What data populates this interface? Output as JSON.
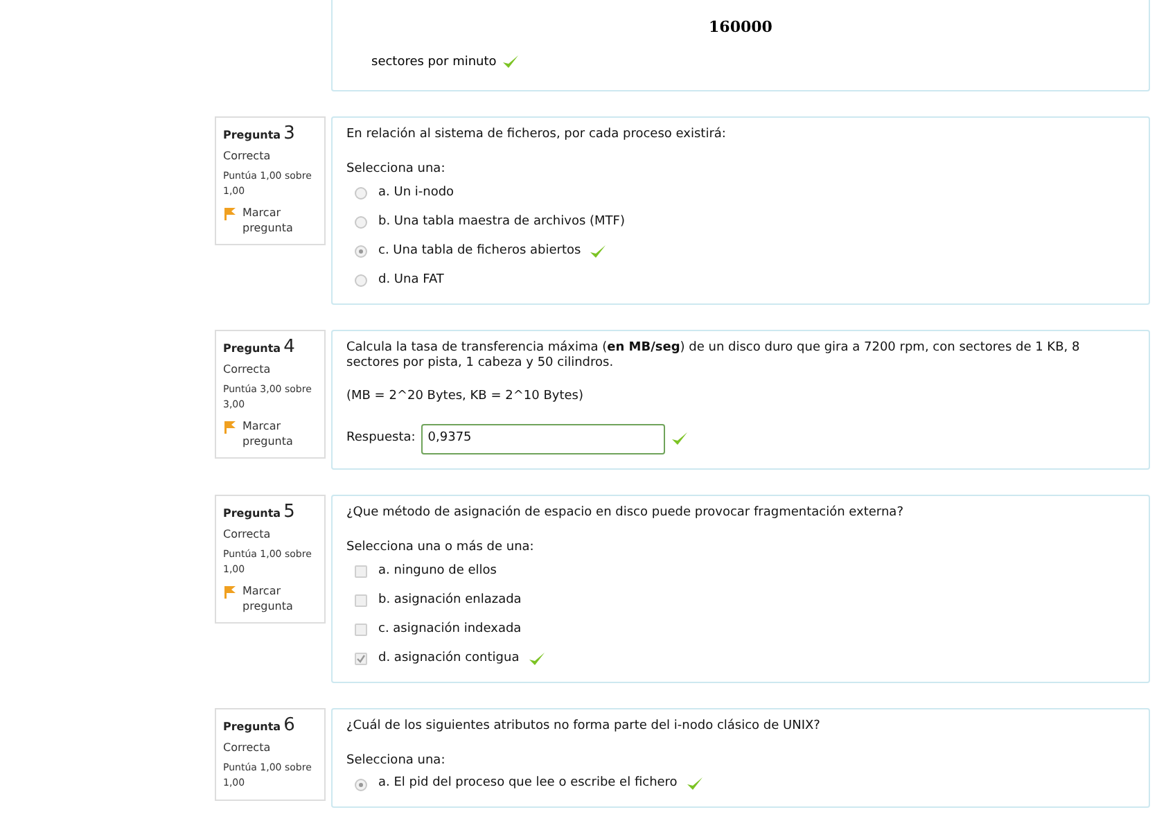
{
  "previous_answer": {
    "value": "160000",
    "unit": "sectores por minuto",
    "correct": true
  },
  "questions": [
    {
      "label": "Pregunta",
      "number": "3",
      "status": "Correcta",
      "score": "Puntúa 1,00 sobre 1,00",
      "flag": "Marcar pregunta",
      "prompt": "En relación al sistema de ficheros, por cada proceso existirá:",
      "kind": "radio",
      "instruction": "Selecciona una:",
      "options": [
        {
          "label": "a. Un i-nodo",
          "selected": false,
          "correct": false
        },
        {
          "label": "b. Una tabla maestra de archivos (MTF)",
          "selected": false,
          "correct": false
        },
        {
          "label": "c. Una tabla de ficheros abiertos",
          "selected": true,
          "correct": true
        },
        {
          "label": "d. Una FAT",
          "selected": false,
          "correct": false
        }
      ]
    },
    {
      "label": "Pregunta",
      "number": "4",
      "status": "Correcta",
      "score": "Puntúa 3,00 sobre 3,00",
      "flag": "Marcar pregunta",
      "prompt": "Calcula la tasa de transferencia máxima (**en MB/seg**) de un disco duro que gira a 7200 rpm, con sectores de 1 KB, 8 sectores por pista, 1 cabeza y 50 cilindros.",
      "kind": "numeric",
      "note": "(MB = 2^20 Bytes, KB = 2^10 Bytes)",
      "answer_label": "Respuesta:",
      "answer": "0,9375",
      "correct": true
    },
    {
      "label": "Pregunta",
      "number": "5",
      "status": "Correcta",
      "score": "Puntúa 1,00 sobre 1,00",
      "flag": "Marcar pregunta",
      "prompt": "¿Que método de asignación de espacio en disco puede provocar fragmentación externa?",
      "kind": "checkbox",
      "instruction": "Selecciona una o más de una:",
      "options": [
        {
          "label": "a. ninguno de ellos",
          "selected": false,
          "correct": false
        },
        {
          "label": "b. asignación enlazada",
          "selected": false,
          "correct": false
        },
        {
          "label": "c. asignación indexada",
          "selected": false,
          "correct": false
        },
        {
          "label": "d. asignación contigua",
          "selected": true,
          "correct": true
        }
      ]
    },
    {
      "label": "Pregunta",
      "number": "6",
      "status": "Correcta",
      "score": "Puntúa 1,00 sobre 1,00",
      "prompt": "¿Cuál de los siguientes atributos no forma parte del i-nodo clásico de UNIX?",
      "kind": "radio",
      "instruction": "Selecciona una:",
      "options": [
        {
          "label": "a. El pid del proceso que lee o escribe el fichero",
          "selected": true,
          "correct": true
        }
      ]
    }
  ]
}
